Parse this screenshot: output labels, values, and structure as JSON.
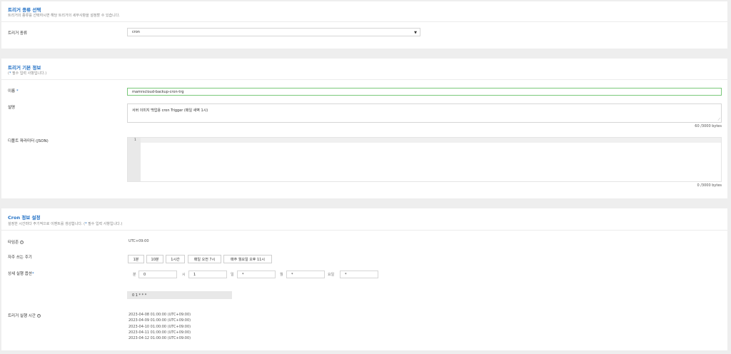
{
  "section1": {
    "title": "트리거 종류 선택",
    "subtitle": "트리거의 종류를 선택하시면 해당 트리거의 세부사항을 설정할 수 있습니다.",
    "type_label": "트리거 종류",
    "type_value": "cron"
  },
  "section2": {
    "title": "트리거 기본 정보",
    "subtitle_pre": "(",
    "subtitle_post": " 필수 입력 사항입니다.)",
    "required_mark": "*",
    "name_label": "이름",
    "name_value": "mamrscloud-backup-cron-trg",
    "desc_label": "설명",
    "desc_value": "서버 이미지 백업용 cron Trigger (매일 새벽 1시)",
    "desc_counter": "60 /3000 bytes",
    "params_label": "디폴트 파라미터 (JSON)",
    "params_line_no": "1",
    "params_counter": "0 /3000 bytes"
  },
  "section3": {
    "title": "Cron 정보 설정",
    "subtitle_pre": "설정한 시간마다 주기적으로 이벤트를 생성합니다. (",
    "subtitle_post": " 필수 입력 사항입니다.)",
    "tz_label": "타임존",
    "tz_value": "UTC+09:00",
    "freq_label": "자주 쓰는 주기",
    "freq_buttons": [
      "1분",
      "10분",
      "1시간",
      "매일 오전 7시",
      "매주 월요일 오후 11시"
    ],
    "detail_label": "상세 실행 옵션",
    "fields": {
      "minute_label": "분",
      "minute_value": "0",
      "hour_label": "시",
      "hour_value": "1",
      "day_label": "일",
      "day_value": "*",
      "month_label": "월",
      "month_value": "*",
      "weekday_label": "요일",
      "weekday_value": "*"
    },
    "cron_expr": "0 1 * * *",
    "run_label": "트리거 실행 시간",
    "run_times": [
      "2023-04-08 01:00:00 (UTC+09:00)",
      "2023-04-09 01:00:00 (UTC+09:00)",
      "2023-04-10 01:00:00 (UTC+09:00)",
      "2023-04-11 01:00:00 (UTC+09:00)",
      "2023-04-12 01:00:00 (UTC+09:00)"
    ]
  },
  "icons": {
    "dropdown": "caret-down-icon",
    "help": "help-circle-icon",
    "resize": "resize-handle-icon"
  },
  "colors": {
    "accent": "#1f6fc5",
    "name_border": "#7ac87a"
  }
}
